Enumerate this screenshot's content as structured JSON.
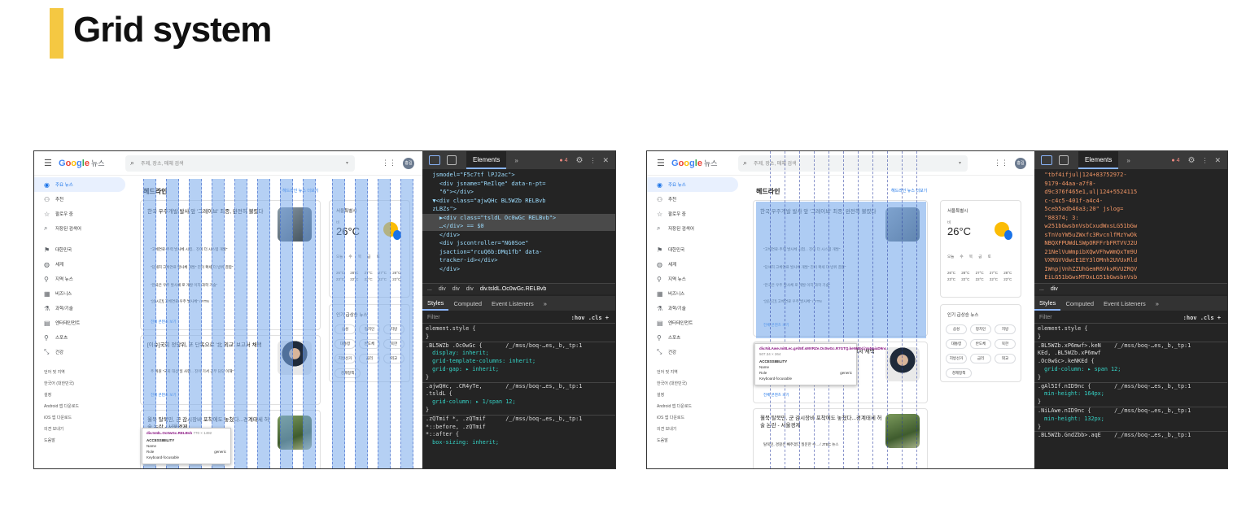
{
  "slide": {
    "title": "Grid system",
    "accent_color": "#f5c842"
  },
  "browser": {
    "logo": {
      "g": "G",
      "o1": "o",
      "o2": "o",
      "g2": "g",
      "l": "l",
      "e": "e",
      "suffix": "뉴스"
    },
    "search_placeholder": "주제, 장소, 매체 검색",
    "avatar_initials": "홍길",
    "sidebar": {
      "items": [
        {
          "icon": "home-icon",
          "glyph": "◉",
          "label": "주요 뉴스"
        },
        {
          "icon": "person-icon",
          "glyph": "⚇",
          "label": "추천"
        },
        {
          "icon": "star-icon",
          "glyph": "☆",
          "label": "팔로우 중"
        },
        {
          "icon": "search-icon",
          "glyph": "⌕",
          "label": "저장된 검색어"
        }
      ],
      "sections": [
        {
          "icon": "flag-icon",
          "glyph": "⚑",
          "label": "대한민국"
        },
        {
          "icon": "globe-icon",
          "glyph": "◍",
          "label": "세계"
        },
        {
          "icon": "pin-icon",
          "glyph": "⚲",
          "label": "지역 뉴스"
        },
        {
          "icon": "business-icon",
          "glyph": "▦",
          "label": "비즈니스"
        },
        {
          "icon": "science-icon",
          "glyph": "⚗",
          "label": "과학/기술"
        },
        {
          "icon": "film-icon",
          "glyph": "▤",
          "label": "엔터테인먼트"
        },
        {
          "icon": "bike-icon",
          "glyph": "⚲",
          "label": "스포츠"
        },
        {
          "icon": "health-icon",
          "glyph": "⤡",
          "label": "건강"
        }
      ],
      "footer": [
        "언어 및 지역",
        "한국어 (대한민국)",
        "설정",
        "Android 앱 다운로드",
        "iOS 앱 다운로드",
        "의견 보내기",
        "도움말"
      ]
    },
    "headlines_title": "헤드라인",
    "headlines_more": "헤드라인 뉴스 더보기",
    "story1": {
      "headline": "한국 우주개발 발사 앞 '그레이브' 최종, 완전히 불렸다",
      "bullets": [
        "“고체연료·추력 발사체 시험... 진이 더 시스템 개발”",
        "“당세히 고체연료 발사체 개발” 진이 확세 더 방위 결합”",
        "“한국은 우주 발사체 로 개발 이지 과학 기술”",
        "“[실시간] 고체연료 우주 발사체” / YTN"
      ],
      "more": "전체 콘텐츠 보기"
    },
    "story2": {
      "headline": "[이슈]국회 정당위, 또 단독으로 '北 외교' 보고서 채택",
      "bullet": "주 위원 “국회 대상 일 사항... 진이 기서 공무 담당 이해”",
      "more": "전체 콘텐츠 보기"
    },
    "story3": {
      "headline": "월북 탈북민, 군 감시장비 포착에도 놓쳤다...경계태세 허술 논란 - 서울경제",
      "bullet": "탈북민, 경찰은 빼주겠다 질문한 수... / JTBC 뉴스"
    },
    "weather": {
      "city": "서울특별시",
      "label": "비",
      "temp": "26°C",
      "days": "오늘 수 목 금 토",
      "temps": "26°C 28°C 27°C 27°C 28°C",
      "lows": "23°C 22°C 22°C 22°C 22°C"
    },
    "trend": {
      "title": "인기 급상승 뉴스",
      "chips": [
        "삼성",
        "정치인",
        "지방",
        "대통령",
        "반도체",
        "북한",
        "지방선거",
        "금리",
        "외교",
        "경제정책"
      ]
    },
    "tooltip1": {
      "selector": "div.tsIdL.Oc0wGc.RELBvb",
      "size": "770 × 1492",
      "section": "ACCESSIBILITY",
      "name_label": "Name",
      "role_label": "Role",
      "role_value": "generic",
      "kb_label": "Keyboard-focusable"
    },
    "tooltip2": {
      "selector": "div.NiLAwe.mi8Lec.gAl5If.sMVRZe.Oc0wGc.R7GTQ.keNKEd.jVsNaiaD9nc",
      "size": "507.34 × 264",
      "section": "ACCESSIBILITY",
      "name_label": "Name",
      "role_label": "Role",
      "role_value": "generic",
      "kb_label": "Keyboard-focusable"
    }
  },
  "devtools1": {
    "tab": "Elements",
    "errors": "4",
    "code": [
      "  jsmodel=\"F5c7tf lPJ2ac\">",
      "    <div jsname=\"ReIlqe\" data-n-pt=",
      "    \"6\"></div>",
      "  ▼<div class=\"ajwQHc BL5WZb RELBvb",
      "  zLBZs\">",
      "    ▶<div class=\"tsldL Oc0wGc RELBvb\">",
      "    …</div> == $0",
      "    </div>",
      "    <div jscontroller=\"NG0Soe\"",
      "    jsaction=\"rcuQ6b:DMq1fb\" data-",
      "    tracker-id></div>",
      "    </div>"
    ],
    "crumbs": [
      "...",
      "div",
      "div",
      "div",
      "div.tsldL.Oc0wGc.RELBvb"
    ],
    "subtabs": [
      "Styles",
      "Computed",
      "Event Listeners",
      "»"
    ],
    "filter": "Filter",
    "filter_right": ":hov .cls +",
    "rules": [
      "element.style {",
      "}",
      ".BL5WZb .Oc0wGc {       /_/mss/boq-…es,_b,_tp:1",
      "  display: inherit;",
      "  grid-template-columns: inherit;",
      "  grid-gap: ▸ inherit;",
      "}",
      ".ajwQHc, .CR4yTe,       /_/mss/boq-…es,_b,_tp:1",
      ".tsldL {",
      "  grid-column: ▸ 1/span 12;",
      "}",
      ".zQTmif *, .zQTmif      /_/mss/boq-…es,_b,_tp:1",
      "*::before, .zQTmif",
      "*::after {",
      "  box-sizing: inherit;"
    ]
  },
  "devtools2": {
    "tab": "Elements",
    "errors": "4",
    "code": [
      "  \"tbf4ifjul|124+83752972-",
      "  9179-44aa-a7f8-",
      "  d9c376f465e1,ul|124+5524115",
      "  c-c4c5-401f-a4c4-",
      "  5ceb5adb46a3;20\" jslog=",
      "  \"88374; 3:",
      "  w251bGwsbnVsbCxudWxsLG51bGw",
      "  sTnVoYW5uZWxfc3RvcnlfMzYwOk",
      "  NBQXFPUWdLSWpORFFrbFRTVVJ2U",
      "  21NelVuWmpibXQwVFhwWmQxTm9U",
      "  VXRGVVdwcE1EY3lOMnh2UVUxRld",
      "  IWnpjVnhZZUhGemR6VkxRVUZRQV",
      "  EiLG51bGwsMTOxLG51bGwsbnVsb"
    ],
    "crumbs": [
      "...",
      "div"
    ],
    "subtabs": [
      "Styles",
      "Computed",
      "Event Listeners",
      "»"
    ],
    "filter": "Filter",
    "filter_right": ":hov .cls +",
    "rules": [
      "element.style {",
      "}",
      ".BL5WZb.xP6mwf>.keN    /_/mss/boq-…es,_b,_tp:1",
      "KEd, .BL5WZb.xP6mwf",
      ".Oc0wGc>.keNKEd {",
      "  grid-column: ▸ span 12;",
      "}",
      ".gAl5If.nID9nc {       /_/mss/boq-…es,_b,_tp:1",
      "  min-height: 164px;",
      "}",
      ".NiLAwe.nID9nc {       /_/mss/boq-…es,_b,_tp:1",
      "  min-height: 132px;",
      "}",
      ".BL5WZb.GndZbb>.aqE    /_/mss/boq-…es,_b,_tp:1"
    ]
  }
}
